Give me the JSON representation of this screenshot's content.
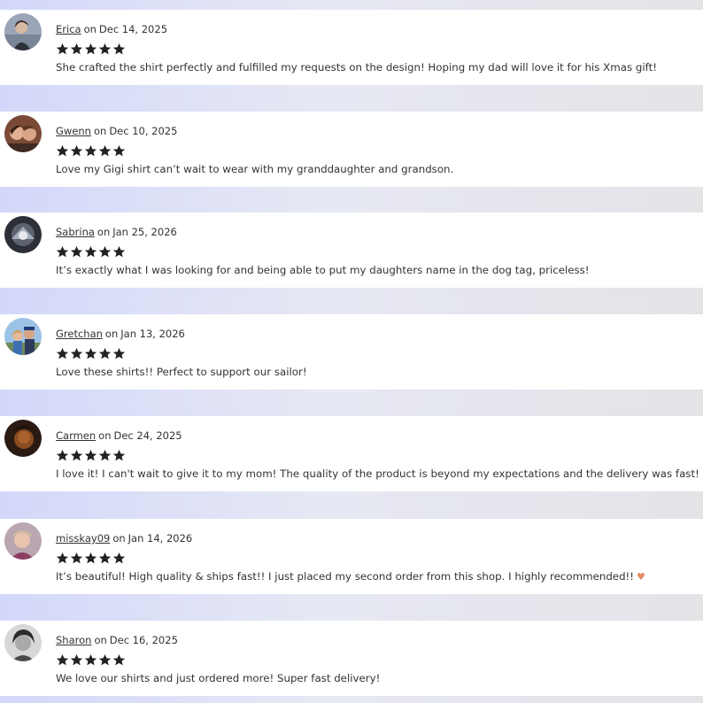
{
  "colors": {
    "card_background": "#ffffff",
    "stars": "#222222",
    "text": "#333333",
    "separator_gradient_left": "#d3d8fa",
    "separator_gradient_right": "#e4e4e7"
  },
  "reviews": [
    {
      "name": "Erica",
      "on_word": "on",
      "date": "Dec 14, 2025",
      "rating": 5,
      "avatar_icon": "avatar-photo-icon",
      "text": "She crafted the shirt perfectly and fulfilled my requests on the design! Hoping my dad will love it for his Xmas gift!"
    },
    {
      "name": "Gwenn",
      "on_word": "on",
      "date": "Dec 10, 2025",
      "rating": 5,
      "avatar_icon": "avatar-photo-icon",
      "text": "Love my Gigi shirt can’t wait to wear with my granddaughter and grandson."
    },
    {
      "name": "Sabrina",
      "on_word": "on",
      "date": "Jan 25, 2026",
      "rating": 5,
      "avatar_icon": "avatar-photo-icon",
      "text": "It’s exactly what I was looking for and being able to put my daughters name in the dog tag, priceless!"
    },
    {
      "name": "Gretchan",
      "on_word": "on",
      "date": "Jan 13, 2026",
      "rating": 5,
      "avatar_icon": "avatar-photo-icon",
      "text": "Love these shirts!! Perfect to support our sailor!"
    },
    {
      "name": "Carmen",
      "on_word": "on",
      "date": "Dec 24, 2025",
      "rating": 5,
      "avatar_icon": "avatar-photo-icon",
      "text": "I love it! I can't wait to give it to my mom! The quality of the product is beyond my expectations and the delivery was fast!"
    },
    {
      "name": "misskay09",
      "on_word": "on",
      "date": "Jan 14, 2026",
      "rating": 5,
      "avatar_icon": "avatar-photo-icon",
      "text": "It’s beautiful! High quality & ships fast!! I just placed my second order from this shop. I highly recommended!!",
      "emoji_icon": "heart-hands-emoji-icon"
    },
    {
      "name": "Sharon",
      "on_word": "on",
      "date": "Dec 16, 2025",
      "rating": 5,
      "avatar_icon": "avatar-photo-icon",
      "text": "We love our shirts and just ordered more! Super fast delivery!"
    }
  ]
}
